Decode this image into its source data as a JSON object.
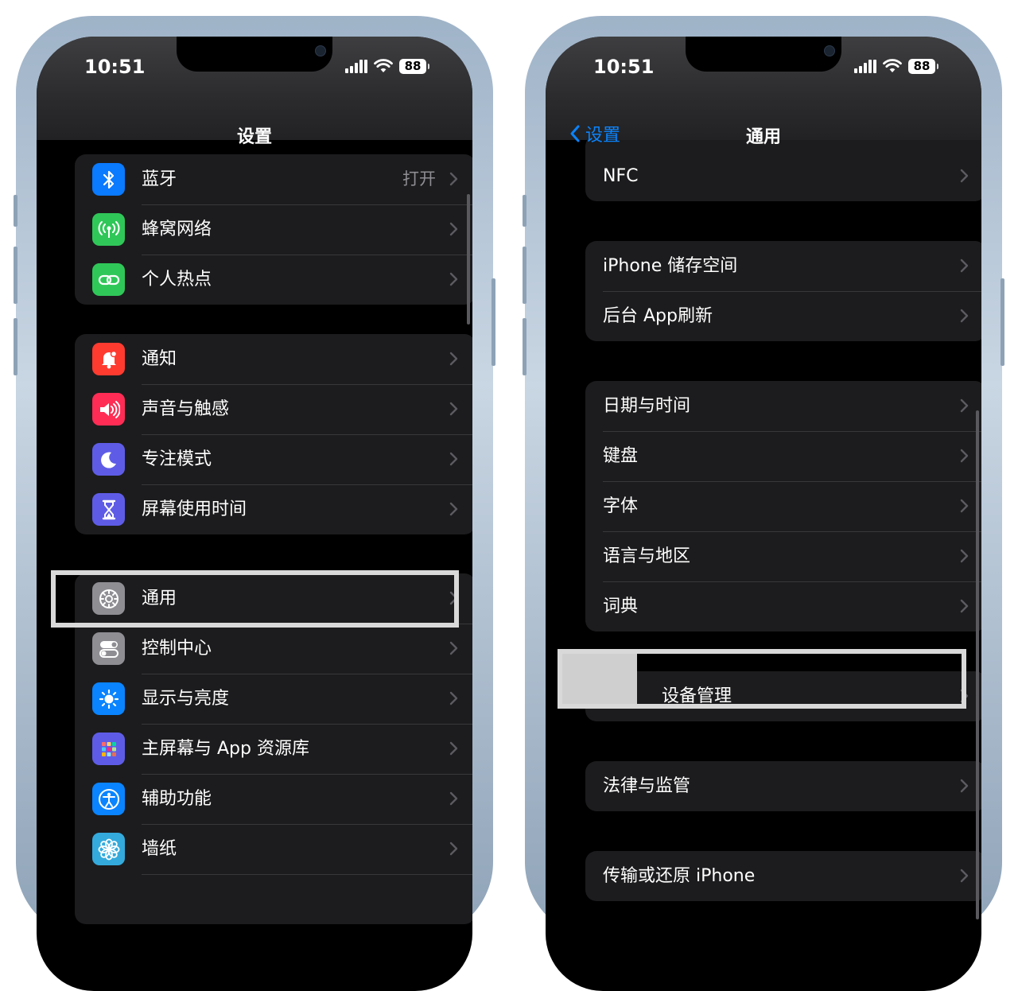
{
  "left_phone": {
    "status_bar": {
      "time": "10:51",
      "battery": "88"
    },
    "nav": {
      "title": "设置"
    },
    "groups": [
      [
        {
          "label": "蓝牙",
          "value": "打开",
          "icon": "bluetooth-icon",
          "icon_color": "#0a7aff"
        },
        {
          "label": "蜂窝网络",
          "icon": "cellular-icon",
          "icon_color": "#30c759"
        },
        {
          "label": "个人热点",
          "icon": "hotspot-icon",
          "icon_color": "#30c759"
        }
      ],
      [
        {
          "label": "通知",
          "icon": "notification-icon",
          "icon_color": "#ff3b30"
        },
        {
          "label": "声音与触感",
          "icon": "sound-icon",
          "icon_color": "#ff2d55"
        },
        {
          "label": "专注模式",
          "icon": "moon-icon",
          "icon_color": "#5e5ce6"
        },
        {
          "label": "屏幕使用时间",
          "icon": "hourglass-icon",
          "icon_color": "#5e5ce6"
        }
      ],
      [
        {
          "label": "通用",
          "icon": "gear-icon",
          "icon_color": "#8e8e93"
        },
        {
          "label": "控制中心",
          "icon": "toggles-icon",
          "icon_color": "#8e8e93"
        },
        {
          "label": "显示与亮度",
          "icon": "brightness-icon",
          "icon_color": "#0a84ff"
        },
        {
          "label": "主屏幕与 App 资源库",
          "icon": "home-grid-icon",
          "icon_color": "#5e5ce6"
        },
        {
          "label": "辅助功能",
          "icon": "accessibility-icon",
          "icon_color": "#0a84ff"
        },
        {
          "label": "墙纸",
          "icon": "flower-icon",
          "icon_color": "#34aadc"
        }
      ]
    ]
  },
  "right_phone": {
    "status_bar": {
      "time": "10:51",
      "battery": "88"
    },
    "nav": {
      "back_label": "设置",
      "title": "通用"
    },
    "groups": [
      [
        {
          "label": "NFC"
        }
      ],
      [
        {
          "label": "iPhone 储存空间"
        },
        {
          "label": "后台 App刷新"
        }
      ],
      [
        {
          "label": "日期与时间"
        },
        {
          "label": "键盘"
        },
        {
          "label": "字体"
        },
        {
          "label": "语言与地区"
        },
        {
          "label": "词典"
        }
      ],
      [
        {
          "label": "设备管理"
        }
      ],
      [
        {
          "label": "法律与监管"
        }
      ],
      [
        {
          "label": "传输或还原 iPhone"
        }
      ]
    ]
  },
  "colors": {
    "background": "#000000",
    "cell": "#1c1c1e",
    "separator": "#38383a",
    "accent": "#0a84ff",
    "highlight_frame": "#d9d9d9"
  }
}
